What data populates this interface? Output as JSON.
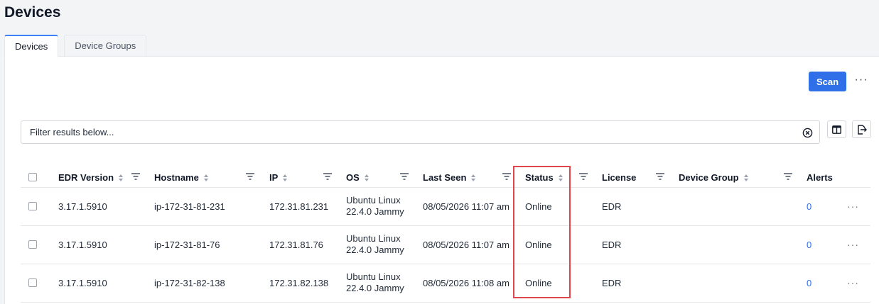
{
  "page": {
    "title": "Devices"
  },
  "tabs": [
    {
      "label": "Devices",
      "active": true
    },
    {
      "label": "Device Groups",
      "active": false
    }
  ],
  "toolbar": {
    "scan_label": "Scan",
    "more_label": "···"
  },
  "filter": {
    "placeholder": "Filter results below...",
    "value": ""
  },
  "table": {
    "columns": [
      "EDR Version",
      "Hostname",
      "IP",
      "OS",
      "Last Seen",
      "Status",
      "License",
      "Device Group",
      "Alerts"
    ],
    "rows": [
      {
        "edr": "3.17.1.5910",
        "hostname": "ip-172-31-81-231",
        "ip": "172.31.81.231",
        "os_line1": "Ubuntu Linux",
        "os_line2": "22.4.0 Jammy",
        "last_seen": "08/05/2026 11:07 am",
        "status": "Online",
        "license": "EDR",
        "device_group": "",
        "alerts": "0"
      },
      {
        "edr": "3.17.1.5910",
        "hostname": "ip-172-31-81-76",
        "ip": "172.31.81.76",
        "os_line1": "Ubuntu Linux",
        "os_line2": "22.4.0 Jammy",
        "last_seen": "08/05/2026 11:07 am",
        "status": "Online",
        "license": "EDR",
        "device_group": "",
        "alerts": "0"
      },
      {
        "edr": "3.17.1.5910",
        "hostname": "ip-172-31-82-138",
        "ip": "172.31.82.138",
        "os_line1": "Ubuntu Linux",
        "os_line2": "22.4.0 Jammy",
        "last_seen": "08/05/2026 11:08 am",
        "status": "Online",
        "license": "EDR",
        "device_group": "",
        "alerts": "0"
      }
    ],
    "row_more_label": "···"
  },
  "colors": {
    "accent": "#2f6fe8",
    "highlight": "#e0474c"
  },
  "icons": [
    "sort-icon",
    "filter-icon",
    "clear-icon",
    "columns-icon",
    "export-icon",
    "more-icon"
  ]
}
